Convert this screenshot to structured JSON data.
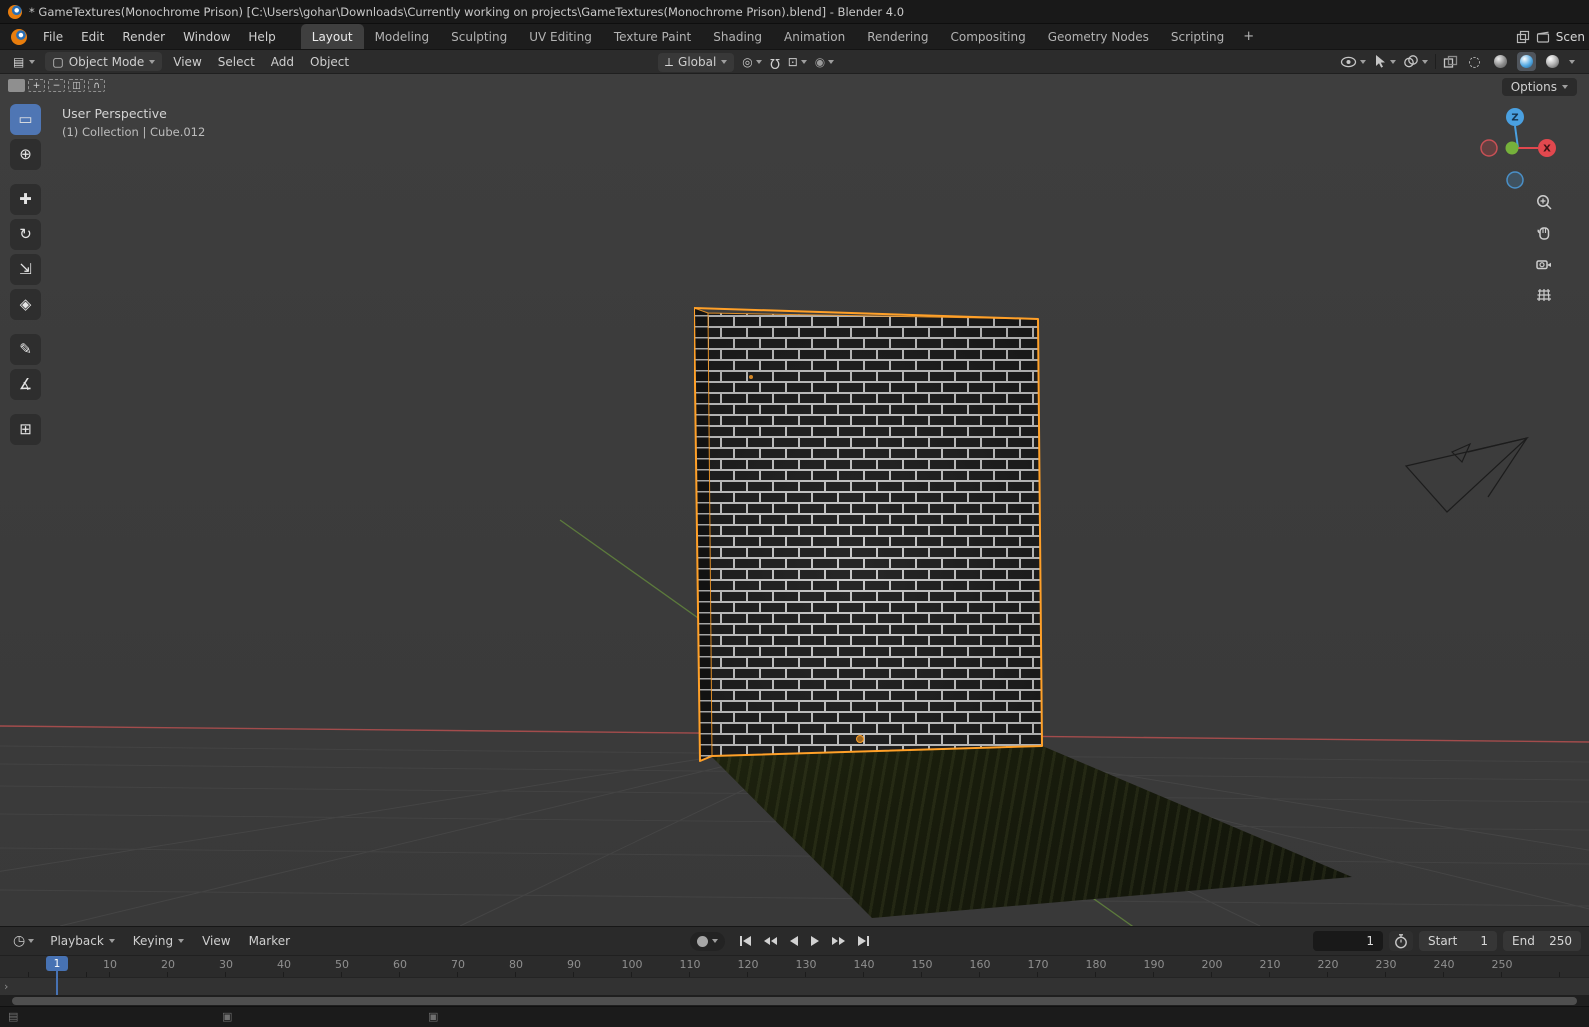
{
  "titlebar": {
    "title": "* GameTextures(Monochrome Prison) [C:\\Users\\gohar\\Downloads\\Currently working on projects\\GameTextures(Monochrome Prison).blend] - Blender 4.0"
  },
  "menubar": {
    "menus": [
      "File",
      "Edit",
      "Render",
      "Window",
      "Help"
    ],
    "workspaces": [
      {
        "label": "Layout",
        "active": true
      },
      {
        "label": "Modeling"
      },
      {
        "label": "Sculpting"
      },
      {
        "label": "UV Editing"
      },
      {
        "label": "Texture Paint"
      },
      {
        "label": "Shading"
      },
      {
        "label": "Animation"
      },
      {
        "label": "Rendering"
      },
      {
        "label": "Compositing"
      },
      {
        "label": "Geometry Nodes"
      },
      {
        "label": "Scripting"
      }
    ],
    "add_workspace": "+",
    "scene_label": "Scen"
  },
  "header": {
    "mode": "Object Mode",
    "menus": [
      "View",
      "Select",
      "Add",
      "Object"
    ],
    "orientation": "Global",
    "options_button": "Options",
    "select_modes": [
      {
        "name": "new",
        "glyph": "",
        "active": true
      },
      {
        "name": "extend",
        "glyph": "+"
      },
      {
        "name": "subtract",
        "glyph": "−"
      },
      {
        "name": "invert",
        "glyph": "◫"
      },
      {
        "name": "intersect",
        "glyph": "∩"
      }
    ]
  },
  "viewport": {
    "view_label": "User Perspective",
    "context_label": "(1) Collection | Cube.012",
    "axis_labels": {
      "x": "X",
      "y": "Y",
      "z": "Z"
    }
  },
  "toolbar": {
    "tools": [
      {
        "name": "select-box-tool",
        "glyph": "▭",
        "active": true
      },
      {
        "name": "cursor-tool",
        "glyph": "⊕"
      },
      {
        "name": "move-tool",
        "glyph": "✚",
        "group_start": true
      },
      {
        "name": "rotate-tool",
        "glyph": "↻"
      },
      {
        "name": "scale-tool",
        "glyph": "⇲"
      },
      {
        "name": "transform-tool",
        "glyph": "◈"
      },
      {
        "name": "annotate-tool",
        "glyph": "✎",
        "group_start": true
      },
      {
        "name": "measure-tool",
        "glyph": "∡"
      },
      {
        "name": "add-cube-tool",
        "glyph": "⊞",
        "group_start": true
      }
    ]
  },
  "timeline": {
    "menus": [
      {
        "label": "Playback",
        "dropdown": true
      },
      {
        "label": "Keying",
        "dropdown": true
      },
      {
        "label": "View"
      },
      {
        "label": "Marker"
      }
    ],
    "current_frame": "1",
    "start_label": "Start",
    "start_value": "1",
    "end_label": "End",
    "end_value": "250",
    "ticks": [
      "10",
      "20",
      "30",
      "40",
      "50",
      "60",
      "70",
      "80",
      "90",
      "100",
      "110",
      "120",
      "130",
      "140",
      "150",
      "160",
      "170",
      "180",
      "190",
      "200",
      "210",
      "220",
      "230",
      "240",
      "250"
    ]
  },
  "icons": {
    "editor_3d_viewport": "▤",
    "mode_object": "▢",
    "orientation_globe": "⟂",
    "pivot_point": "◎",
    "magnet": "Ω",
    "snap_target": "⊡",
    "proportional_editing": "◉",
    "wireframe_sphere": "◌",
    "timeline_editor": "◷",
    "track_expand": "›",
    "status_corner": "▤",
    "status_editor_a": "▣",
    "status_editor_b": "▣"
  },
  "colors": {
    "selection_outline": "#ffa028",
    "accent_blue": "#4772b3",
    "axis_x": "#a34c4c",
    "axis_y": "#5c7a3c",
    "gizmo_x": "#e2484e",
    "gizmo_y": "#76b13b",
    "gizmo_z": "#4aa0e0",
    "mortar": "#c6c6c6",
    "brick": "#1b1b1b",
    "floor_green": "#414824"
  }
}
